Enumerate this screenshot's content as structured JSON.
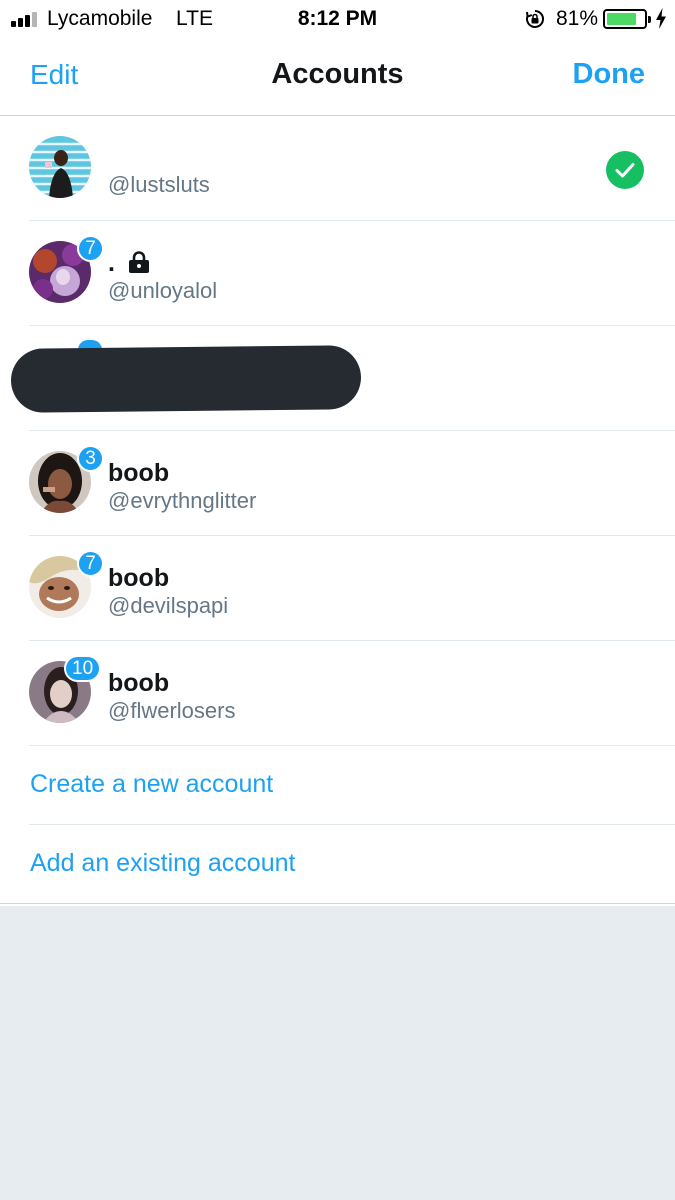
{
  "status_bar": {
    "carrier": "Lycamobile",
    "network": "LTE",
    "time": "8:12 PM",
    "battery_percent": "81%",
    "battery_level": 0.81,
    "signal_bars": 3,
    "signal_max": 4
  },
  "nav": {
    "edit_label": "Edit",
    "title": "Accounts",
    "done_label": "Done"
  },
  "accounts": [
    {
      "display_name": "",
      "handle": "@lustsluts",
      "badge": "",
      "selected": true,
      "avatar_color": "#4fc0dc"
    },
    {
      "display_name": ".",
      "handle": "@unloyalol",
      "badge": "7",
      "protected": true,
      "avatar_color": "#6a2a72"
    },
    {
      "redacted": true
    },
    {
      "display_name": "boob",
      "handle": "@evrythnglitter",
      "badge": "3",
      "avatar_color": "#4a3a34"
    },
    {
      "display_name": "boob",
      "handle": "@devilspapi",
      "badge": "7",
      "avatar_color": "#d9b89a"
    },
    {
      "display_name": "boob",
      "handle": "@flwerlosers",
      "badge": "10",
      "avatar_color": "#a894a8"
    }
  ],
  "actions": {
    "create_label": "Create a new account",
    "add_label": "Add an existing account"
  },
  "colors": {
    "accent": "#1da1f2",
    "check": "#17bf63",
    "secondary_text": "#657786",
    "background_gray": "#e6ecf0",
    "battery_green": "#4cd964",
    "redaction": "#262b31"
  }
}
